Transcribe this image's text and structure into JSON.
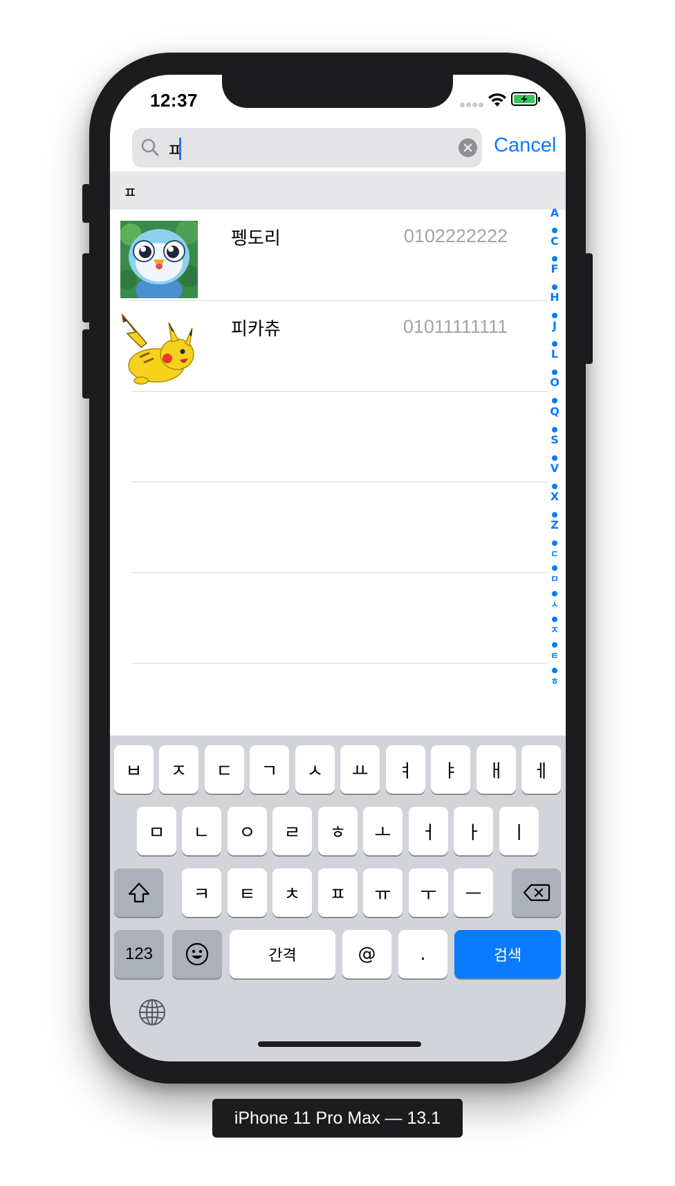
{
  "status_bar": {
    "time": "12:37"
  },
  "search": {
    "query": "ㅍ",
    "cancel_label": "Cancel"
  },
  "section": {
    "title": "ㅍ"
  },
  "contacts": [
    {
      "name": "펭도리",
      "phone": "0102222222",
      "avatar": "piplup-avatar"
    },
    {
      "name": "피카츄",
      "phone": "01011111111",
      "avatar": "pikachu-avatar"
    }
  ],
  "section_index": {
    "letters": [
      "A",
      "C",
      "F",
      "H",
      "J",
      "L",
      "O",
      "Q",
      "S",
      "V",
      "X",
      "Z",
      "ㄷ",
      "ㅁ",
      "ㅅ",
      "ㅈ",
      "ㅌ",
      "ㅎ"
    ]
  },
  "keyboard": {
    "row1": [
      "ㅂ",
      "ㅈ",
      "ㄷ",
      "ㄱ",
      "ㅅ",
      "ㅛ",
      "ㅕ",
      "ㅑ",
      "ㅐ",
      "ㅔ"
    ],
    "row2": [
      "ㅁ",
      "ㄴ",
      "ㅇ",
      "ㄹ",
      "ㅎ",
      "ㅗ",
      "ㅓ",
      "ㅏ",
      "ㅣ"
    ],
    "row3": [
      "ㅋ",
      "ㅌ",
      "ㅊ",
      "ㅍ",
      "ㅠ",
      "ㅜ",
      "ㅡ"
    ],
    "numbers_label": "123",
    "space_label": "간격",
    "at_label": "@",
    "period_label": ".",
    "search_label": "검색"
  },
  "simulator": {
    "device_label": "iPhone 11 Pro Max — 13.1"
  },
  "colors": {
    "accent": "#0a7aff",
    "keyboard_bg": "#d1d4d9",
    "device_frame": "#1c1c1e"
  }
}
